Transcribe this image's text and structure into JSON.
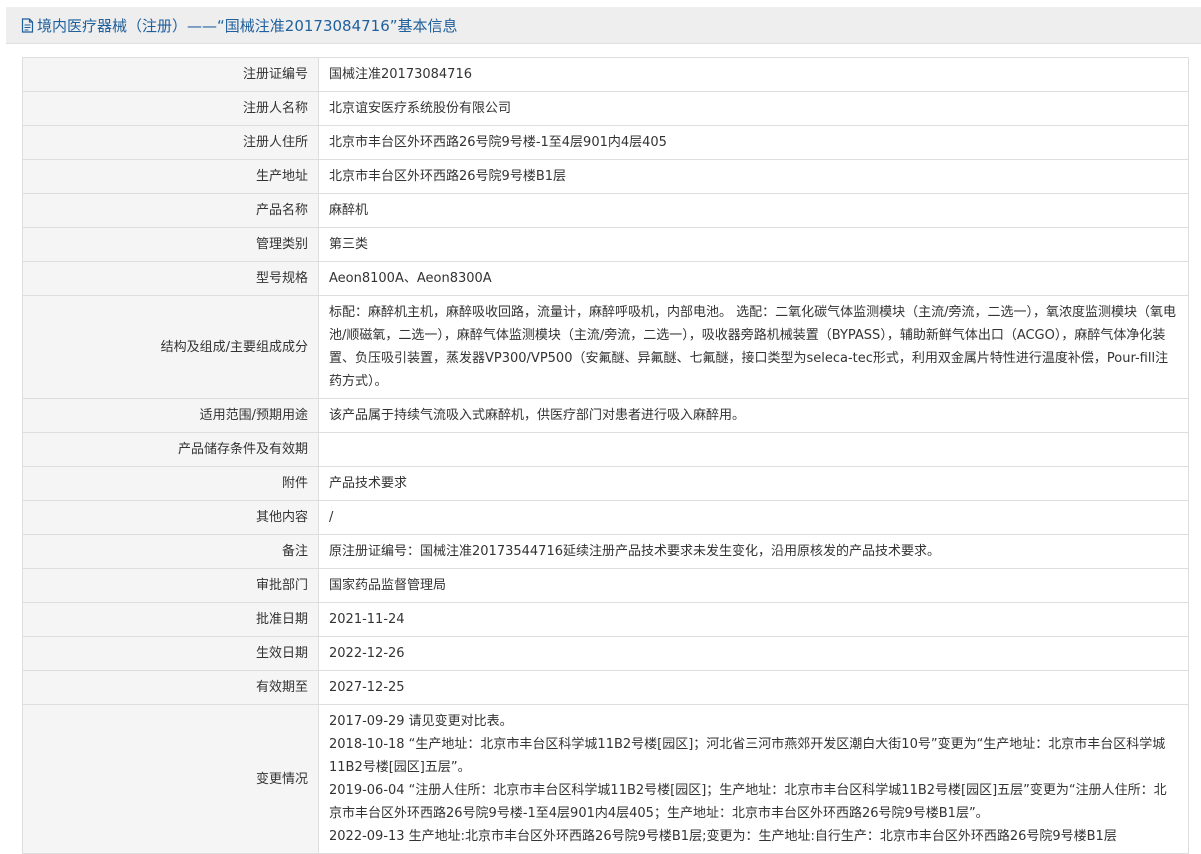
{
  "header": {
    "title": "境内医疗器械（注册）——“国械注准20173084716”基本信息",
    "icon": "document-icon",
    "color": "#1e5f9c"
  },
  "rows": [
    {
      "label": "注册证编号",
      "value": "国械注准20173084716"
    },
    {
      "label": "注册人名称",
      "value": "北京谊安医疗系统股份有限公司"
    },
    {
      "label": "注册人住所",
      "value": "北京市丰台区外环西路26号院9号楼-1至4层901内4层405"
    },
    {
      "label": "生产地址",
      "value": "北京市丰台区外环西路26号院9号楼B1层"
    },
    {
      "label": "产品名称",
      "value": "麻醉机"
    },
    {
      "label": "管理类别",
      "value": "第三类"
    },
    {
      "label": "型号规格",
      "value": "Aeon8100A、Aeon8300A"
    },
    {
      "label": "结构及组成/主要组成成分",
      "value": "标配：麻醉机主机，麻醉吸收回路，流量计，麻醉呼吸机，内部电池。 选配：二氧化碳气体监测模块（主流/旁流，二选一），氧浓度监测模块（氧电池/顺磁氧，二选一），麻醉气体监测模块（主流/旁流，二选一），吸收器旁路机械装置（BYPASS），辅助新鲜气体出口（ACGO），麻醉气体净化装置、负压吸引装置，蒸发器VP300/VP500（安氟醚、异氟醚、七氟醚，接口类型为seleca-tec形式，利用双金属片特性进行温度补偿，Pour-fill注药方式）。"
    },
    {
      "label": "适用范围/预期用途",
      "value": "该产品属于持续气流吸入式麻醉机，供医疗部门对患者进行吸入麻醉用。"
    },
    {
      "label": "产品储存条件及有效期",
      "value": ""
    },
    {
      "label": "附件",
      "value": "产品技术要求"
    },
    {
      "label": "其他内容",
      "value": "/"
    },
    {
      "label": "备注",
      "value": "原注册证编号：国械注准20173544716延续注册产品技术要求未发生变化，沿用原核发的产品技术要求。"
    },
    {
      "label": "审批部门",
      "value": "国家药品监督管理局"
    },
    {
      "label": "批准日期",
      "value": "2021-11-24"
    },
    {
      "label": "生效日期",
      "value": "2022-12-26"
    },
    {
      "label": "有效期至",
      "value": "2027-12-25"
    }
  ],
  "changes": {
    "label": "变更情况",
    "entries": [
      "2017-09-29 请见变更对比表。",
      "2018-10-18 “生产地址：北京市丰台区科学城11B2号楼[园区]；河北省三河市燕郊开发区潮白大街10号”变更为“生产地址：北京市丰台区科学城11B2号楼[园区]五层”。",
      "2019-06-04 “注册人住所：北京市丰台区科学城11B2号楼[园区]；生产地址：北京市丰台区科学城11B2号楼[园区]五层”变更为“注册人住所：北京市丰台区外环西路26号院9号楼-1至4层901内4层405；生产地址：北京市丰台区外环西路26号院9号楼B1层”。",
      "2022-09-13 生产地址:北京市丰台区外环西路26号院9号楼B1层;变更为：生产地址:自行生产：北京市丰台区外环西路26号院9号楼B1层"
    ]
  }
}
